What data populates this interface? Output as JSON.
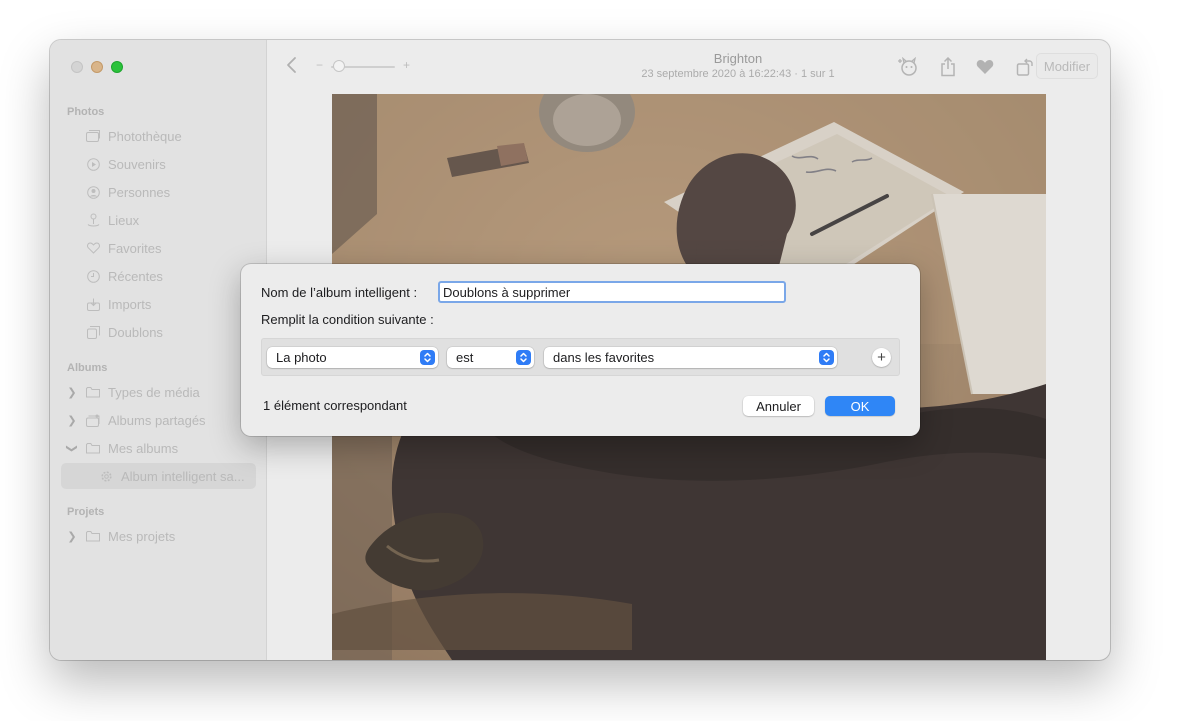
{
  "toolbar": {
    "title": "Brighton",
    "subtitle": "23 septembre 2020 à 16:22:43 · 1 sur 1",
    "zoom_minus": "−",
    "zoom_plus": "+",
    "edit_label": "Modifier",
    "icons": [
      "chevron-left-icon",
      "pet-face-icon",
      "share-icon",
      "heart-icon",
      "rotate-icon",
      "magic-wand-icon"
    ]
  },
  "sidebar": {
    "photos_header": "Photos",
    "photos_items": [
      {
        "label": "Photothèque",
        "icon": "photo-library-icon"
      },
      {
        "label": "Souvenirs",
        "icon": "memories-icon"
      },
      {
        "label": "Personnes",
        "icon": "people-icon"
      },
      {
        "label": "Lieux",
        "icon": "places-pin-icon"
      },
      {
        "label": "Favorites",
        "icon": "heart-icon"
      },
      {
        "label": "Récentes",
        "icon": "clock-icon"
      },
      {
        "label": "Imports",
        "icon": "import-icon"
      },
      {
        "label": "Doublons",
        "icon": "duplicates-icon"
      }
    ],
    "albums_header": "Albums",
    "albums_items": [
      {
        "label": "Types de média",
        "icon": "folder-icon"
      },
      {
        "label": "Albums partagés",
        "icon": "shared-album-icon"
      },
      {
        "label": "Mes albums",
        "icon": "folder-icon"
      },
      {
        "label": "Album intelligent sa...",
        "icon": "gear-icon"
      }
    ],
    "projects_header": "Projets",
    "projects_items": [
      {
        "label": "Mes projets",
        "icon": "folder-icon"
      }
    ]
  },
  "dialog": {
    "name_label": "Nom de l’album intelligent :",
    "name_value": "Doublons à supprimer",
    "condition_label": "Remplit la condition suivante :",
    "rule": {
      "field": "La photo",
      "operator": "est",
      "value": "dans les favorites"
    },
    "add_rule": "+",
    "match_count": "1 élément correspondant",
    "cancel_label": "Annuler",
    "ok_label": "OK"
  },
  "colors": {
    "accent": "#2f86f6",
    "sidebar_bg": "#e2e2e2",
    "dialog_bg": "#ececec"
  }
}
